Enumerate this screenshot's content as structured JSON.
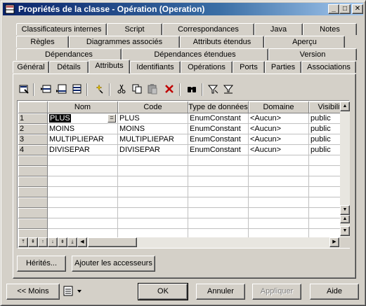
{
  "window": {
    "title": "Propriétés de la classe - Opération (Operation)",
    "controls": {
      "minimize": "_",
      "maximize": "□",
      "close": "✕"
    }
  },
  "tabs": {
    "row1": [
      "Classificateurs internes",
      "Script",
      "Correspondances",
      "Java",
      "Notes"
    ],
    "row2": [
      "Règles",
      "Diagrammes associés",
      "Attributs étendus",
      "Aperçu"
    ],
    "row3": [
      "Dépendances",
      "Dépendances étendues",
      "Version"
    ],
    "row4": [
      "Général",
      "Détails",
      "Attributs",
      "Identifiants",
      "Opérations",
      "Ports",
      "Parties",
      "Associations"
    ],
    "active": "Attributs"
  },
  "toolbar": {
    "icons": [
      "properties-icon",
      "insert-row-icon",
      "add-row-icon",
      "add-attributes-icon",
      "new-icon",
      "cut-icon",
      "copy-icon",
      "paste-icon",
      "delete-icon",
      "find-icon",
      "filter-icon",
      "clear-filter-icon"
    ]
  },
  "grid": {
    "columns": [
      "Nom",
      "Code",
      "Type de données",
      "Domaine",
      "Visibilit"
    ],
    "rows": [
      {
        "num": "1",
        "nom": "PLUS",
        "code": "PLUS",
        "type": "EnumConstant",
        "domaine": "<Aucun>",
        "visibilite": "public"
      },
      {
        "num": "2",
        "nom": "MOINS",
        "code": "MOINS",
        "type": "EnumConstant",
        "domaine": "<Aucun>",
        "visibilite": "public"
      },
      {
        "num": "3",
        "nom": "MULTIPLIEPAR",
        "code": "MULTIPLIEPAR",
        "type": "EnumConstant",
        "domaine": "<Aucun>",
        "visibilite": "public"
      },
      {
        "num": "4",
        "nom": "DIVISEPAR",
        "code": "DIVISEPAR",
        "type": "EnumConstant",
        "domaine": "<Aucun>",
        "visibilite": "public"
      }
    ],
    "empty_rows": 9,
    "edit_button": "="
  },
  "panel_buttons": {
    "herites": "Hérités...",
    "ajouter": "Ajouter les accesseurs"
  },
  "footer": {
    "moins": "<< Moins",
    "ok": "OK",
    "annuler": "Annuler",
    "appliquer": "Appliquer",
    "aide": "Aide"
  }
}
